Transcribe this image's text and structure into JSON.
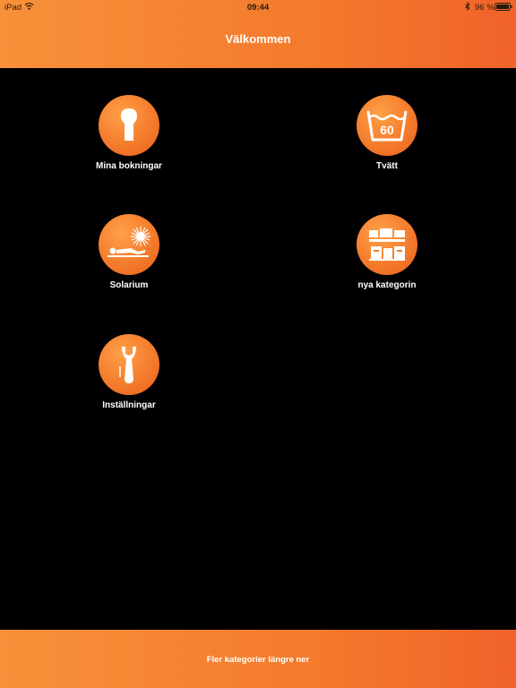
{
  "status_bar": {
    "device": "iPad",
    "time": "09:44",
    "battery": "96 %"
  },
  "header": {
    "title": "Välkommen"
  },
  "tiles": [
    {
      "label": "Mina bokningar",
      "icon": "key-icon"
    },
    {
      "label": "Tvätt",
      "icon": "wash-60-icon",
      "icon_text": "60"
    },
    {
      "label": "Solarium",
      "icon": "sunbed-icon"
    },
    {
      "label": "nya kategorin",
      "icon": "boxes-icon"
    },
    {
      "label": "Inställningar",
      "icon": "wrench-icon"
    }
  ],
  "footer": {
    "label": "Fler kategorier längre ner"
  },
  "colors": {
    "accent": "#f47a2c",
    "background": "#000000",
    "text": "#ffffff"
  }
}
